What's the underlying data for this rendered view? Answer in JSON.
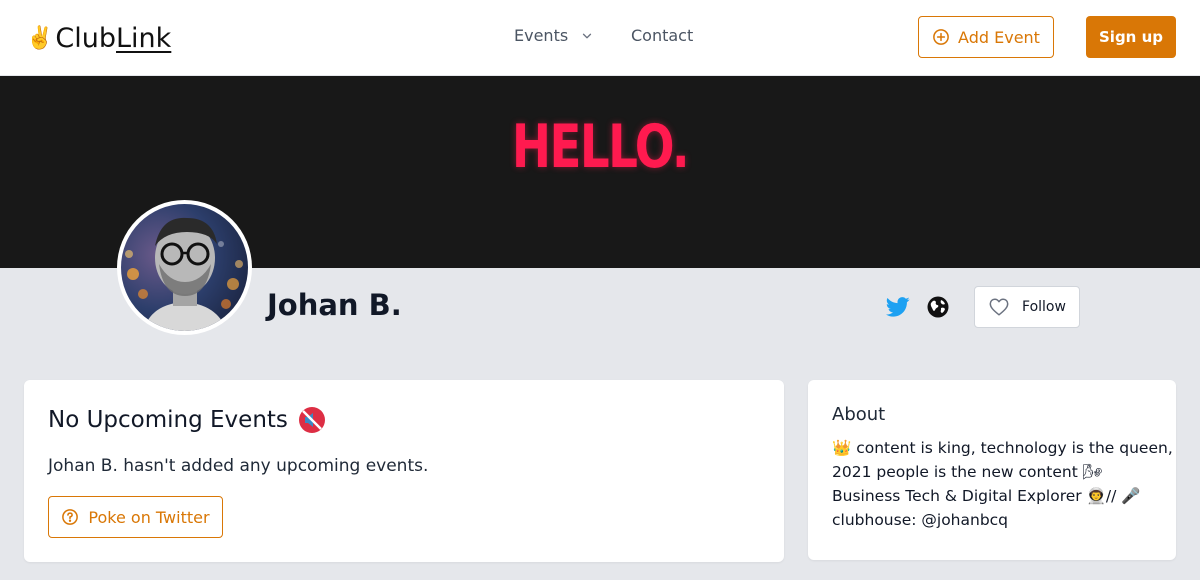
{
  "header": {
    "logo": {
      "emoji": "✌️",
      "text_a": "Club",
      "text_b": "Link"
    },
    "nav": {
      "events_label": "Events",
      "contact_label": "Contact"
    },
    "add_event_label": "Add Event",
    "sign_up_label": "Sign up"
  },
  "banner": {
    "text": "HELLO."
  },
  "profile": {
    "name": "Johan B.",
    "follow_label": "Follow"
  },
  "events_card": {
    "title": "No Upcoming Events",
    "message": "Johan B. hasn't added any upcoming events.",
    "poke_label": "Poke on Twitter"
  },
  "about_card": {
    "title": "About",
    "lines": [
      "👑 content is king, technology is the queen,",
      "2021 people is the new content 🌬",
      "Business Tech & Digital Explorer 👨‍🚀// 🎤",
      "clubhouse: @johanbcq"
    ]
  },
  "colors": {
    "accent": "#d97706",
    "banner_bg": "#181818",
    "banner_text": "#ff1a4f",
    "twitter": "#1da1f2",
    "page_bg": "#e5e7eb"
  },
  "icons": [
    "chevron-down-icon",
    "plus-circle-icon",
    "twitter-icon",
    "globe-icon",
    "heart-icon",
    "muted-speaker-icon",
    "question-circle-icon"
  ]
}
